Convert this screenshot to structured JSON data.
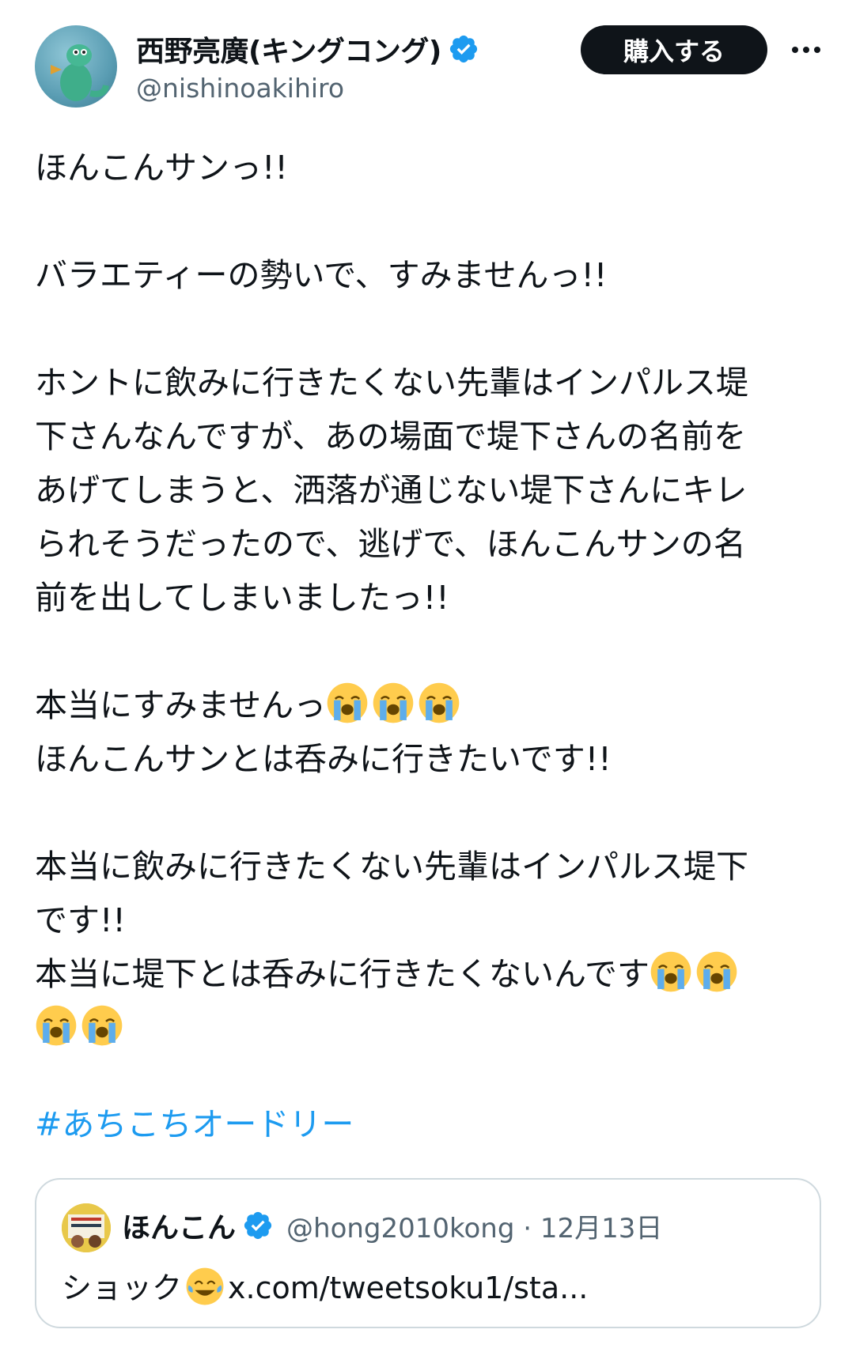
{
  "author": {
    "display_name": "西野亮廣(キングコング)",
    "handle": "@nishinoakihiro",
    "verified": true
  },
  "actions": {
    "buy_label": "購入する",
    "more_icon": "more-horizontal-icon"
  },
  "tweet": {
    "paragraphs": [
      [
        "ほんこんサンっ!!"
      ],
      [
        "バラエティーの勢いで、すみませんっ!!"
      ],
      [
        "ホントに飲みに行きたくない先輩はインパルス堤",
        "下さんなんですが、あの場面で堤下さんの名前を",
        "あげてしまうと、洒落が通じない堤下さんにキレ",
        "られそうだったので、逃げで、ほんこんサンの名",
        "前を出してしまいましたっ!!"
      ],
      [
        "本当にすみませんっ",
        "ほんこんサンとは呑みに行きたいです!!"
      ],
      [
        "本当に飲みに行きたくない先輩はインパルス堤下",
        "です!!",
        "本当に堤下とは呑みに行きたくないんです"
      ]
    ],
    "hashtag": "#あちこちオードリー"
  },
  "quote": {
    "display_name": "ほんこん",
    "handle_date": "@hong2010kong · 12月13日",
    "text": "ショック",
    "link": "x.com/tweetsoku1/sta..."
  },
  "colors": {
    "text": "#0f1419",
    "secondary": "#536471",
    "link": "#1d9bf0",
    "verified": "#1d9bf0",
    "border": "#cfd9de"
  }
}
